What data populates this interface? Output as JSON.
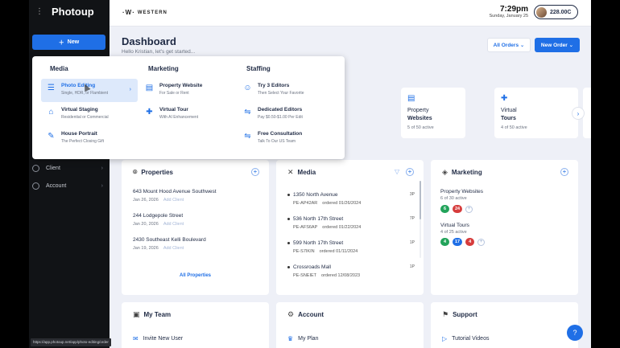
{
  "app": {
    "name": "Photoup"
  },
  "sidebar": {
    "new_label": "New",
    "items": [
      {
        "label": "Client"
      },
      {
        "label": "Account"
      }
    ],
    "status_url": "https://app.photoup.net/app/photo-editing/order"
  },
  "topbar": {
    "brand": "WESTERN",
    "time": "7:29pm",
    "date": "Sunday, January 25",
    "balance": "228.00C"
  },
  "dashboard": {
    "title": "Dashboard",
    "subtitle": "Hello Kristian, let's get started...",
    "all_orders": "All Orders",
    "new_order": "New Order"
  },
  "service_cards": [
    {
      "line1": "Property",
      "line2": "Websites",
      "status": "5 of 50 active",
      "icon": "website-icon"
    },
    {
      "line1": "Virtual",
      "line2": "Tours",
      "status": "4 of 50 active",
      "icon": "tour-icon"
    }
  ],
  "properties": {
    "title": "Properties",
    "rows": [
      {
        "address": "643 Mount Hood Avenue Southwest",
        "date": "Jan 26, 2026",
        "add": "Add Client"
      },
      {
        "address": "244 Lodgepole Street",
        "date": "Jan 20, 2026",
        "add": "Add Client"
      },
      {
        "address": "2430 Southeast Kelli Boulevard",
        "date": "Jan 19, 2026",
        "add": "Add Client"
      }
    ],
    "all_link": "All Properties"
  },
  "media": {
    "title": "Media",
    "rows": [
      {
        "address": "1350 North Avenue",
        "count": "3P",
        "code": "PE-AP42AR",
        "ordered": "ordered 01/26/2024"
      },
      {
        "address": "536 North 17th Street",
        "count": "7P",
        "code": "PE-AFS6AP",
        "ordered": "ordered 01/22/2024"
      },
      {
        "address": "599 North 17th Street",
        "count": "1P",
        "code": "PE-S7IKIN",
        "ordered": "ordered 01/11/2024"
      },
      {
        "address": "Crossroads Mall",
        "count": "1P",
        "code": "PE-SNEIET",
        "ordered": "ordered 12/08/2023"
      }
    ]
  },
  "marketing": {
    "title": "Marketing",
    "groups": [
      {
        "title": "Property Websites",
        "sub": "6 of 30 active",
        "badges": [
          {
            "v": "6",
            "c": "#22a35a"
          },
          {
            "v": "24",
            "c": "#d63c3c"
          }
        ]
      },
      {
        "title": "Virtual Tours",
        "sub": "4 of 25 active",
        "badges": [
          {
            "v": "4",
            "c": "#22a35a"
          },
          {
            "v": "17",
            "c": "#1f6fe6"
          },
          {
            "v": "4",
            "c": "#d63c3c"
          }
        ]
      }
    ]
  },
  "team": {
    "title": "My Team",
    "item": "Invite New User"
  },
  "account": {
    "title": "Account",
    "item": "My Plan"
  },
  "support": {
    "title": "Support",
    "item": "Tutorial Videos"
  },
  "mega_menu": {
    "columns": [
      {
        "heading": "Media",
        "items": [
          {
            "title": "Photo Editing",
            "sub": "Single, HDR, or Flambient",
            "icon": "sliders-icon",
            "active": true
          },
          {
            "title": "Virtual Staging",
            "sub": "Residential or Commercial",
            "icon": "sofa-icon"
          },
          {
            "title": "House Portrait",
            "sub": "The Perfect Closing Gift",
            "icon": "brush-icon"
          }
        ]
      },
      {
        "heading": "Marketing",
        "items": [
          {
            "title": "Property Website",
            "sub": "For Sale or Rent",
            "icon": "website-icon"
          },
          {
            "title": "Virtual Tour",
            "sub": "With AI Enhancement",
            "icon": "tour-icon"
          }
        ]
      },
      {
        "heading": "Staffing",
        "items": [
          {
            "title": "Try 3 Editors",
            "sub": "Then Select Your Favorite",
            "icon": "people-icon"
          },
          {
            "title": "Dedicated Editors",
            "sub": "Pay $0.50-$1.00 Per Edit",
            "icon": "handshake-icon"
          },
          {
            "title": "Free Consultation",
            "sub": "Talk To Our US Team",
            "icon": "handshake-icon"
          }
        ]
      }
    ]
  },
  "colors": {
    "accent": "#1f6fe6",
    "sidebar": "#111316",
    "background": "#eef0f7"
  }
}
